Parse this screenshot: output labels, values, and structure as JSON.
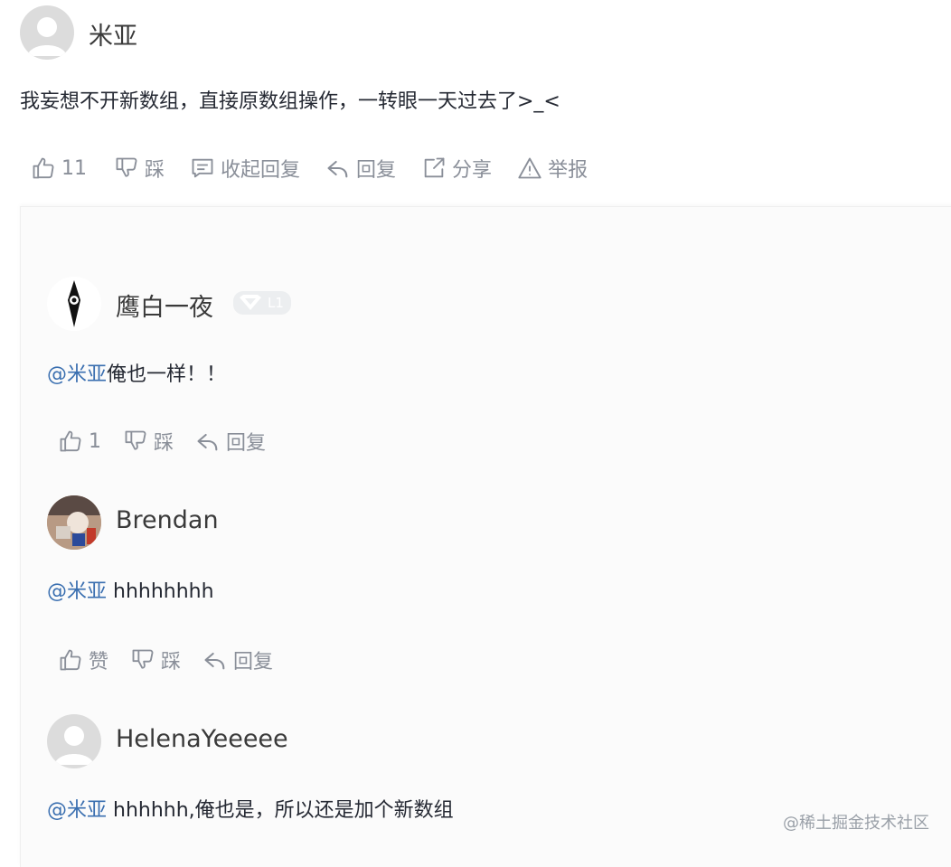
{
  "main_comment": {
    "author": "米亚",
    "content": "我妄想不开新数组，直接原数组操作，一转眼一天过去了>_<",
    "actions": {
      "like_count": "11",
      "dislike": "踩",
      "collapse_replies": "收起回复",
      "reply": "回复",
      "share": "分享",
      "report": "举报"
    }
  },
  "replies": [
    {
      "author": "鹰白一夜",
      "level_badge": "L1",
      "mention": "@米亚",
      "content": "俺也一样！！",
      "like_count": "1",
      "dislike": "踩",
      "reply": "回复"
    },
    {
      "author": "Brendan",
      "mention": "@米亚",
      "content": " hhhhhhhh",
      "like": "赞",
      "dislike": "踩",
      "reply": "回复"
    },
    {
      "author": "HelenaYeeeee",
      "mention": "@米亚",
      "content": " hhhhhh,俺也是，所以还是加个新数组"
    }
  ],
  "watermark": "@稀土掘金技术社区",
  "colors": {
    "mention": "#3a6fb0",
    "action_gray": "#8a8f99",
    "text": "#252933"
  }
}
